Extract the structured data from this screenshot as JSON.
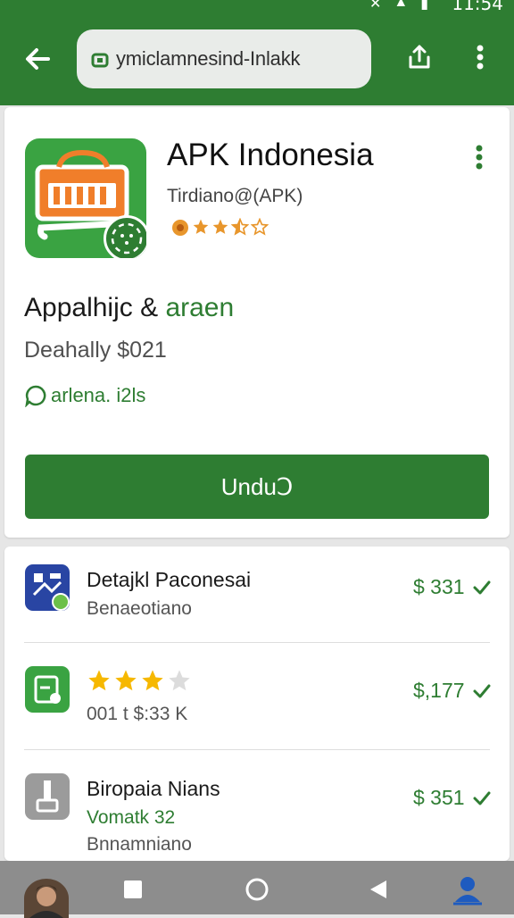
{
  "status": {
    "time": "11:54"
  },
  "toolbar": {
    "url": "ymiclamnesind-Inlakk"
  },
  "app": {
    "title": "APK Indonesia",
    "subtitle": "Tirdiano@(APK)",
    "rating_stars": 3.5,
    "heading_main": "Appalhijc & ",
    "heading_accent": "araen",
    "price_line": "Deahally $021",
    "chat_line": "arlena. i2ls",
    "download_label": "UnduↃ"
  },
  "list": {
    "rows": [
      {
        "title": "Detajkl Paconesai",
        "subtitle": "Benaeotiano",
        "price": "$ 331"
      },
      {
        "rating_stars": 3,
        "meta": "001 t $:33 K",
        "price": "$,177"
      },
      {
        "title": "Biropaia Nians",
        "subtitle": "Vomatk 32",
        "detail": "Bnnamniano",
        "price": "$ 351"
      }
    ]
  },
  "colors": {
    "primary": "#2e7d32",
    "accent_orange": "#f07e2a",
    "star": "#f6b800"
  }
}
